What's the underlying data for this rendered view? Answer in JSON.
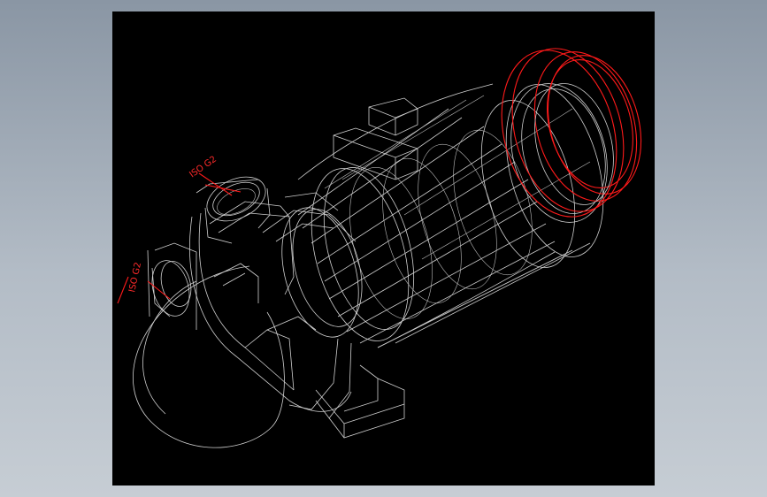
{
  "annotations": {
    "top_flange_label": "ISO G2",
    "side_flange_label": "ISO G2"
  },
  "colors": {
    "background": "#9aa5b1",
    "viewport": "#000000",
    "wireframe": "#d0d0d0",
    "highlight": "#ff1a1a"
  }
}
